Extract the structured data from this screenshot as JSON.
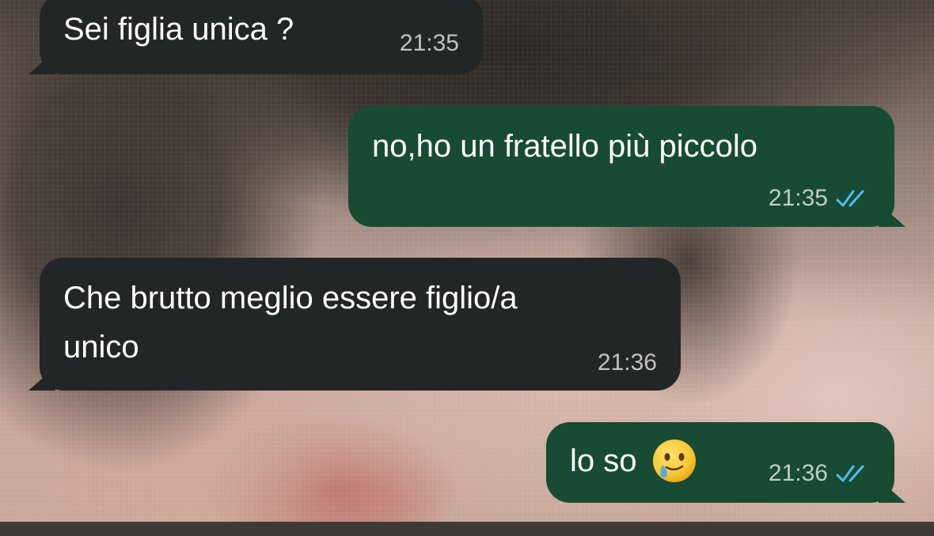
{
  "chat": {
    "messages": [
      {
        "direction": "incoming",
        "text": "Sei figlia unica ?",
        "time": "21:35"
      },
      {
        "direction": "outgoing",
        "text": "no,ho un fratello più piccolo",
        "time": "21:35",
        "status": "read"
      },
      {
        "direction": "incoming",
        "text_line1": "Che brutto meglio essere figlio/a",
        "text_line2": "unico",
        "time": "21:36"
      },
      {
        "direction": "outgoing",
        "text": "lo so",
        "emoji": "face-holding-back-tears",
        "time": "21:36",
        "status": "read"
      }
    ]
  },
  "colors": {
    "incoming_bubble": "#232626",
    "outgoing_bubble": "#174b34",
    "read_ticks": "#53bdeb"
  }
}
